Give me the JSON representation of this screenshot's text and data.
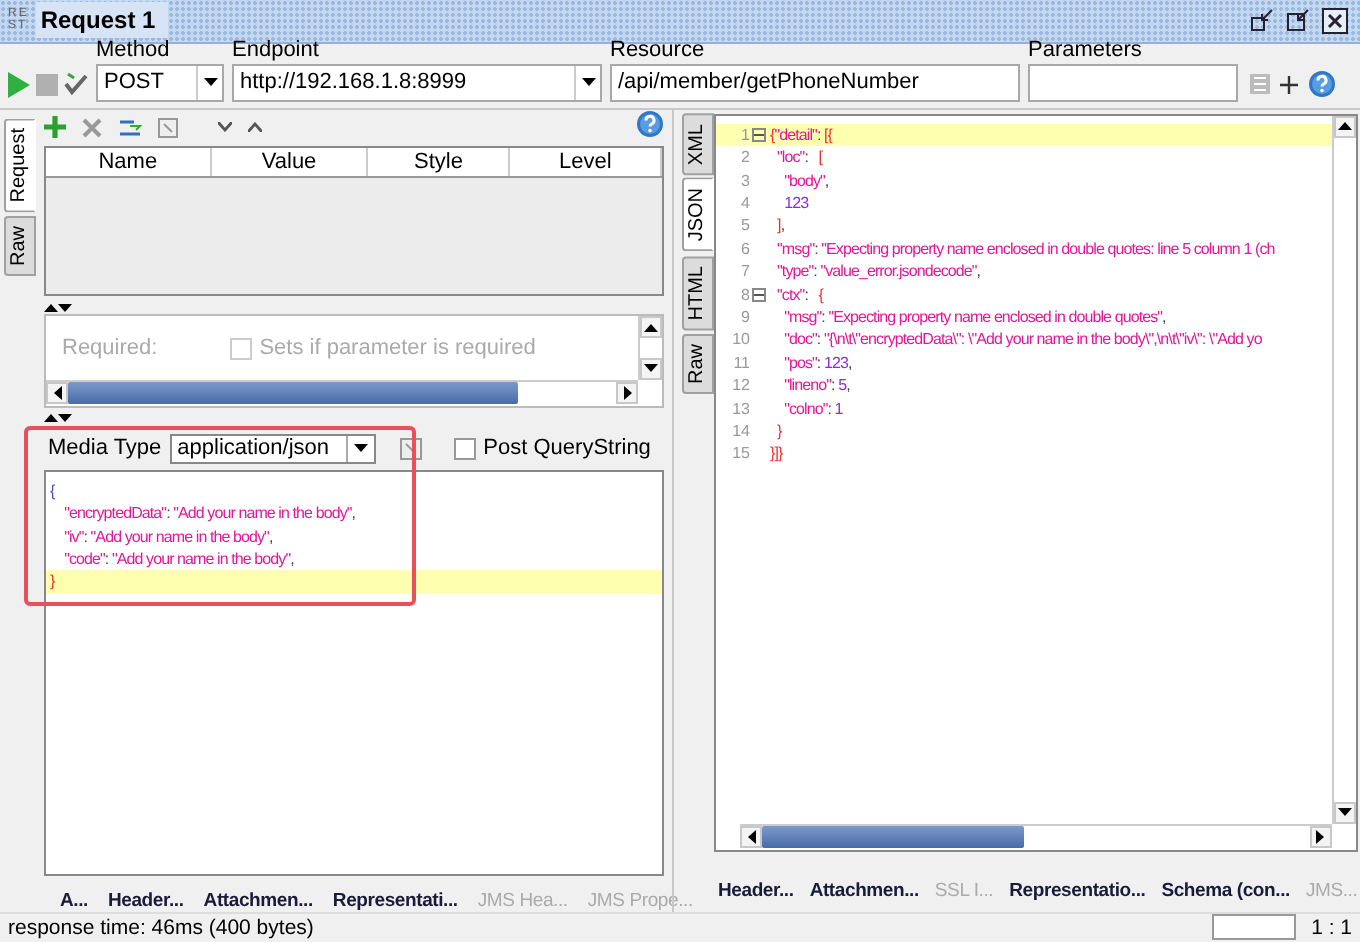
{
  "window": {
    "title": "Request 1",
    "logo": [
      "RE",
      "ST"
    ]
  },
  "toolbar": {
    "method": {
      "label": "Method",
      "value": "POST"
    },
    "endpoint": {
      "label": "Endpoint",
      "value": "http://192.168.1.8:8999"
    },
    "resource": {
      "label": "Resource",
      "value": "/api/member/getPhoneNumber"
    },
    "parameters": {
      "label": "Parameters"
    }
  },
  "request": {
    "side_tabs": [
      {
        "label": "Request",
        "selected": true
      },
      {
        "label": "Raw",
        "selected": false
      }
    ],
    "params_table": {
      "columns": [
        "Name",
        "Value",
        "Style",
        "Level"
      ]
    },
    "required": {
      "label": "Required:",
      "checkbox_label": "Sets if parameter is required",
      "checked": false,
      "disabled": true
    },
    "media_type": {
      "label": "Media Type",
      "value": "application/json"
    },
    "post_querystring": {
      "label": "Post QueryString",
      "checked": false
    },
    "annotation": true,
    "body_lines": [
      {
        "highlighted": false,
        "parts": [
          {
            "kind": "brace",
            "text": "{"
          }
        ]
      },
      {
        "highlighted": false,
        "parts": [
          {
            "kind": "key",
            "text": "    \"encryptedData\""
          },
          {
            "kind": "punct",
            "text": ": "
          },
          {
            "kind": "str",
            "text": "\"Add your name in the body\""
          },
          {
            "kind": "punct",
            "text": ","
          }
        ]
      },
      {
        "highlighted": false,
        "parts": [
          {
            "kind": "key",
            "text": "    \"iv\""
          },
          {
            "kind": "punct",
            "text": ": "
          },
          {
            "kind": "str",
            "text": "\"Add your name in the body\""
          },
          {
            "kind": "punct",
            "text": ","
          }
        ]
      },
      {
        "highlighted": false,
        "parts": [
          {
            "kind": "key",
            "text": "    \"code\""
          },
          {
            "kind": "punct",
            "text": ": "
          },
          {
            "kind": "str",
            "text": "\"Add your name in the body\""
          },
          {
            "kind": "punct",
            "text": ","
          }
        ]
      },
      {
        "highlighted": true,
        "parts": [
          {
            "kind": "bracket",
            "text": "}"
          }
        ]
      }
    ],
    "bottom_tabs": [
      {
        "label": "A...",
        "disabled": false
      },
      {
        "label": "Header...",
        "disabled": false
      },
      {
        "label": "Attachmen...",
        "disabled": false
      },
      {
        "label": "Representati...",
        "disabled": false
      },
      {
        "label": "JMS Hea...",
        "disabled": true
      },
      {
        "label": "JMS Prope...",
        "disabled": true
      }
    ]
  },
  "response": {
    "side_tabs": [
      {
        "label": "XML",
        "selected": false
      },
      {
        "label": "JSON",
        "selected": true
      },
      {
        "label": "HTML",
        "selected": false
      },
      {
        "label": "Raw",
        "selected": false
      }
    ],
    "lines": [
      {
        "number": "1",
        "foldable": true,
        "highlighted": true,
        "parts": [
          {
            "kind": "bracket",
            "text": "{"
          },
          {
            "kind": "key",
            "text": "\"detail\""
          },
          {
            "kind": "punct",
            "text": ": "
          },
          {
            "kind": "bracket",
            "text": "[{"
          }
        ]
      },
      {
        "number": "2",
        "foldable": false,
        "highlighted": false,
        "parts": [
          {
            "kind": "key",
            "text": "  \"loc\""
          },
          {
            "kind": "punct",
            "text": ":   "
          },
          {
            "kind": "bracket",
            "text": "["
          }
        ]
      },
      {
        "number": "3",
        "foldable": false,
        "highlighted": false,
        "parts": [
          {
            "kind": "str",
            "text": "    \"body\""
          },
          {
            "kind": "punct",
            "text": ","
          }
        ]
      },
      {
        "number": "4",
        "foldable": false,
        "highlighted": false,
        "parts": [
          {
            "kind": "num",
            "text": "    123"
          }
        ]
      },
      {
        "number": "5",
        "foldable": false,
        "highlighted": false,
        "parts": [
          {
            "kind": "bracket",
            "text": "  ]"
          },
          {
            "kind": "punct",
            "text": ","
          }
        ]
      },
      {
        "number": "6",
        "foldable": false,
        "highlighted": false,
        "parts": [
          {
            "kind": "key",
            "text": "  \"msg\""
          },
          {
            "kind": "punct",
            "text": ": "
          },
          {
            "kind": "str",
            "text": "\"Expecting property name enclosed in double quotes: line 5 column 1 (ch"
          }
        ]
      },
      {
        "number": "7",
        "foldable": false,
        "highlighted": false,
        "parts": [
          {
            "kind": "key",
            "text": "  \"type\""
          },
          {
            "kind": "punct",
            "text": ": "
          },
          {
            "kind": "str",
            "text": "\"value_error.jsondecode\""
          },
          {
            "kind": "punct",
            "text": ","
          }
        ]
      },
      {
        "number": "8",
        "foldable": true,
        "highlighted": false,
        "parts": [
          {
            "kind": "key",
            "text": "  \"ctx\""
          },
          {
            "kind": "punct",
            "text": ":   "
          },
          {
            "kind": "bracket",
            "text": "{"
          }
        ]
      },
      {
        "number": "9",
        "foldable": false,
        "highlighted": false,
        "parts": [
          {
            "kind": "key",
            "text": "    \"msg\""
          },
          {
            "kind": "punct",
            "text": ": "
          },
          {
            "kind": "str",
            "text": "\"Expecting property name enclosed in double quotes\""
          },
          {
            "kind": "punct",
            "text": ","
          }
        ]
      },
      {
        "number": "10",
        "foldable": false,
        "highlighted": false,
        "parts": [
          {
            "kind": "key",
            "text": "    \"doc\""
          },
          {
            "kind": "punct",
            "text": ": "
          },
          {
            "kind": "str",
            "text": "\"{\\n\\t\\\"encryptedData\\\": \\\"Add your name in the body\\\",\\n\\t\\\"iv\\\": \\\"Add yo"
          }
        ]
      },
      {
        "number": "11",
        "foldable": false,
        "highlighted": false,
        "parts": [
          {
            "kind": "key",
            "text": "    \"pos\""
          },
          {
            "kind": "punct",
            "text": ": "
          },
          {
            "kind": "num",
            "text": "123"
          },
          {
            "kind": "punct",
            "text": ","
          }
        ]
      },
      {
        "number": "12",
        "foldable": false,
        "highlighted": false,
        "parts": [
          {
            "kind": "key",
            "text": "    \"lineno\""
          },
          {
            "kind": "punct",
            "text": ": "
          },
          {
            "kind": "num",
            "text": "5"
          },
          {
            "kind": "punct",
            "text": ","
          }
        ]
      },
      {
        "number": "13",
        "foldable": false,
        "highlighted": false,
        "parts": [
          {
            "kind": "key",
            "text": "    \"colno\""
          },
          {
            "kind": "punct",
            "text": ": "
          },
          {
            "kind": "num",
            "text": "1"
          }
        ]
      },
      {
        "number": "14",
        "foldable": false,
        "highlighted": false,
        "parts": [
          {
            "kind": "bracket",
            "text": "  }"
          }
        ]
      },
      {
        "number": "15",
        "foldable": false,
        "highlighted": false,
        "parts": [
          {
            "kind": "bracket",
            "text": "}]}"
          }
        ]
      }
    ],
    "bottom_tabs": [
      {
        "label": "Header...",
        "disabled": false
      },
      {
        "label": "Attachmen...",
        "disabled": false
      },
      {
        "label": "SSL I...",
        "disabled": true
      },
      {
        "label": "Representatio...",
        "disabled": false
      },
      {
        "label": "Schema (con...",
        "disabled": false
      },
      {
        "label": "JMS...",
        "disabled": true
      }
    ]
  },
  "status_bar": {
    "text": "response time: 46ms (400 bytes)",
    "position": "1 : 1"
  }
}
